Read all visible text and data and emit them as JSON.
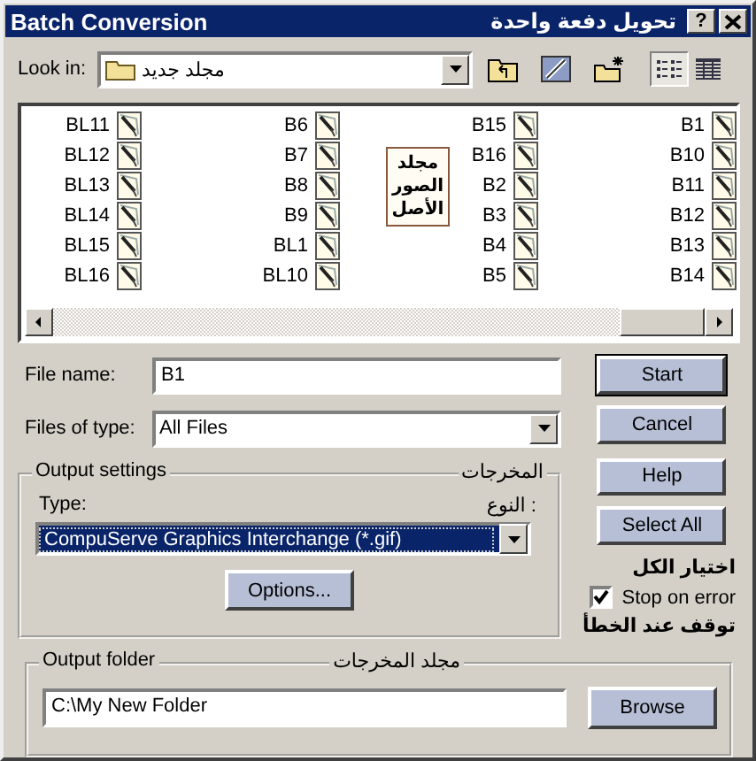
{
  "window": {
    "title": "Batch Conversion",
    "title_ar": "تحويل دفعة واحدة",
    "help": "?"
  },
  "look_in": {
    "label": "Look in:",
    "value": "مجلد جديد"
  },
  "file_list": {
    "columns": [
      [
        "BL11",
        "BL12",
        "BL13",
        "BL14",
        "BL15",
        "BL16"
      ],
      [
        "B6",
        "B7",
        "B8",
        "B9",
        "BL1",
        "BL10"
      ],
      [
        "B15",
        "B16",
        "B2",
        "B3",
        "B4",
        "B5"
      ],
      [
        "B1",
        "B10",
        "B11",
        "B12",
        "B13",
        "B14"
      ]
    ],
    "note": "مجلد الصور الأصل"
  },
  "file_name": {
    "label": "File name:",
    "value": "B1"
  },
  "files_of_type": {
    "label": "Files of type:",
    "value": "All Files"
  },
  "buttons": [
    {
      "label": "Start",
      "default": true
    },
    {
      "label": "Cancel",
      "default": false
    },
    {
      "label": "Help",
      "default": false
    },
    {
      "label": "Select All",
      "default": false
    }
  ],
  "select_all_note": "اختيار الكل",
  "stop_on_error": {
    "label": "Stop on error",
    "checked": true,
    "note": "توقف عند الخطأ"
  },
  "output_settings": {
    "legend": "Output settings",
    "legend_ar": "المخرجات",
    "type_label": "Type:",
    "type_label_ar": "النوع :",
    "type_value": "CompuServe Graphics Interchange (*.gif)",
    "options_button": "Options..."
  },
  "output_folder": {
    "legend": "Output folder",
    "legend_ar": "مجلد المخرجات",
    "value": "C:\\My New Folder",
    "browse_button": "Browse"
  }
}
